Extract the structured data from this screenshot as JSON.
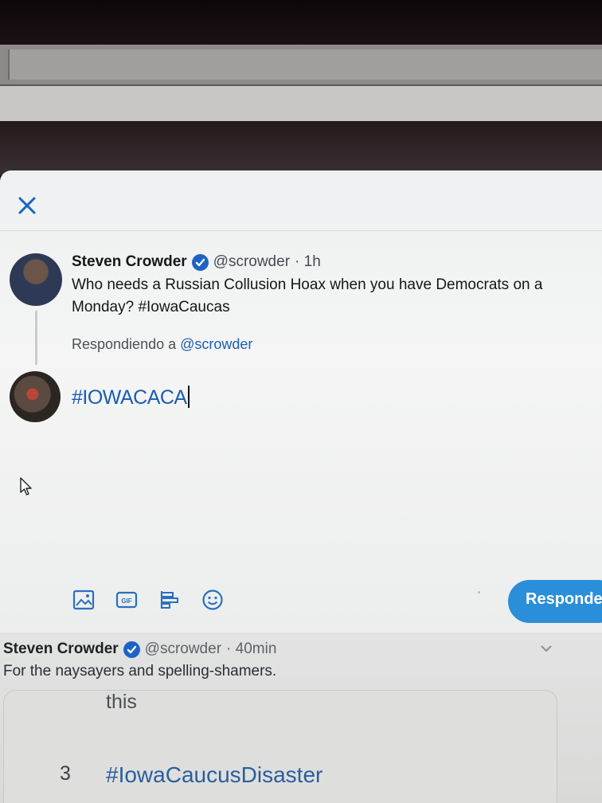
{
  "modal": {
    "close_label": "close",
    "original_tweet": {
      "author_name": "Steven Crowder",
      "handle": "@scrowder",
      "time": "· 1h",
      "text": "Who needs a Russian Collusion Hoax when you have Democrats on a Monday? #IowaCaucas"
    },
    "replying_to_prefix": "Respondiendo a",
    "replying_to_handle": "@scrowder",
    "compose_text": "#IOWACACA",
    "toolbar": {
      "icons": [
        "image-icon",
        "gif-icon",
        "poll-icon",
        "emoji-icon"
      ],
      "gif_label": "GIF"
    },
    "reply_button_label": "Responder"
  },
  "background_tweet": {
    "author_name": "Steven Crowder",
    "handle": "@scrowder",
    "time": "· 40min",
    "text": "For the naysayers and spelling-shamers.",
    "embed": {
      "line1": "this",
      "rank": "3",
      "hashtag": "#IowaCaucusDisaster"
    }
  },
  "colors": {
    "accent": "#1d63c4",
    "reply_button": "#2a8ed9",
    "link": "#1a5fb4"
  }
}
